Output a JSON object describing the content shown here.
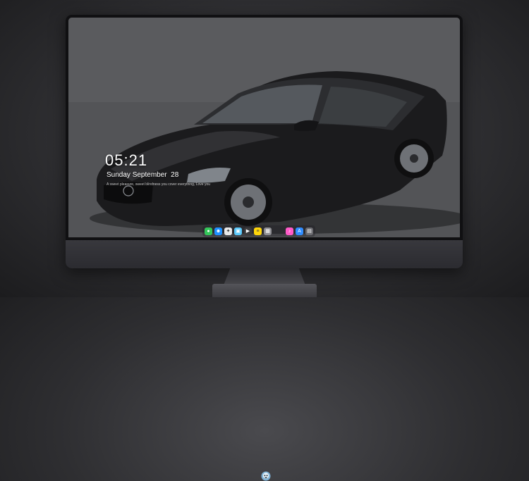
{
  "lockscreen": {
    "time": "05:21",
    "date": "Sunday September  28",
    "quote": "A sweet pleasure, sweet blindness you cover everything, Love you"
  },
  "dock": {
    "apps": [
      {
        "name": "messages",
        "glyph": "●",
        "color": "#34c759"
      },
      {
        "name": "finder",
        "glyph": "☻",
        "color": "#1e90ff"
      },
      {
        "name": "safari",
        "glyph": "✦",
        "color": "#e8e8e8"
      },
      {
        "name": "preview",
        "glyph": "▣",
        "color": "#5ac8fa"
      },
      {
        "name": "clapper",
        "glyph": "▶",
        "color": "#3a3a3c"
      },
      {
        "name": "notes",
        "glyph": "≡",
        "color": "#ffd60a"
      },
      {
        "name": "photos",
        "glyph": "▦",
        "color": "#8e8e93"
      },
      {
        "name": "itunes",
        "glyph": "♪",
        "color": "#ff5ac8"
      },
      {
        "name": "app-store",
        "glyph": "A",
        "color": "#2f8cff"
      },
      {
        "name": "trash",
        "glyph": "▤",
        "color": "#6b6b70"
      }
    ]
  },
  "colors": {
    "monitor_bezel": "#101012",
    "chin": "#2b2b30",
    "car_body": "#1a1a1c"
  }
}
